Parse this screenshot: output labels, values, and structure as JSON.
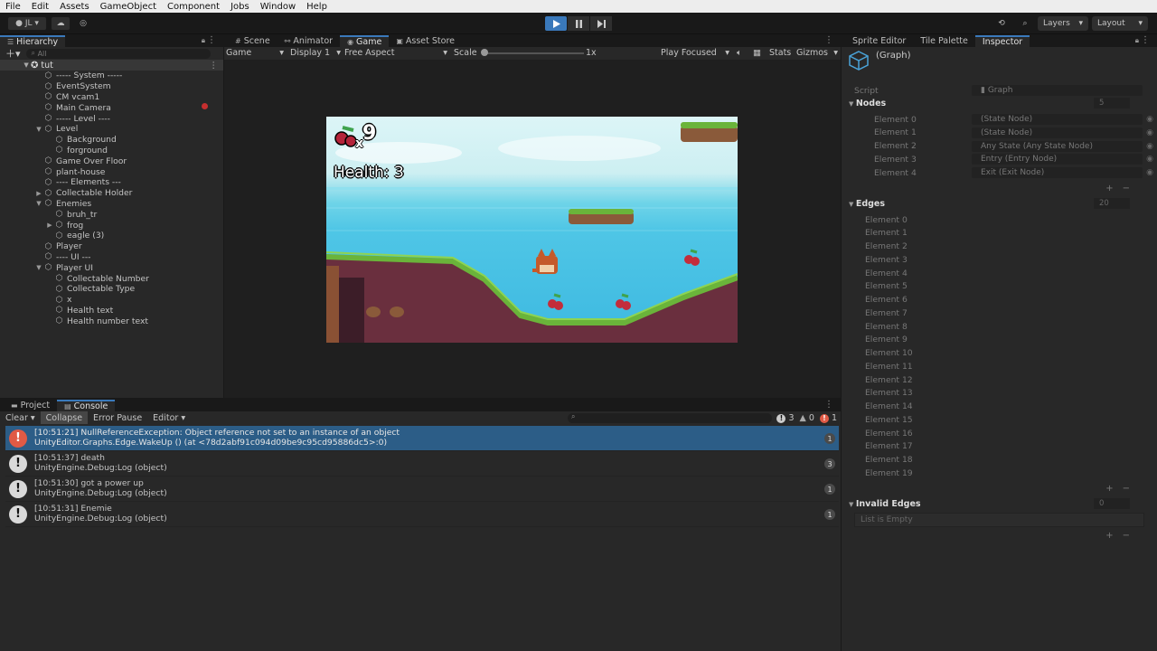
{
  "menu": [
    "File",
    "Edit",
    "Assets",
    "GameObject",
    "Component",
    "Jobs",
    "Window",
    "Help"
  ],
  "toolbar": {
    "account": "JL",
    "layers": "Layers",
    "layout": "Layout"
  },
  "hierarchy": {
    "tab": "Hierarchy",
    "search_placeholder": "All",
    "scene": "tut",
    "items": [
      {
        "label": "----- System -----",
        "depth": 1,
        "fold": ""
      },
      {
        "label": "EventSystem",
        "depth": 1,
        "fold": ""
      },
      {
        "label": "CM vcam1",
        "depth": 1,
        "fold": ""
      },
      {
        "label": "Main Camera",
        "depth": 1,
        "fold": ""
      },
      {
        "label": "----- Level ----",
        "depth": 1,
        "fold": ""
      },
      {
        "label": "Level",
        "depth": 1,
        "fold": "▼"
      },
      {
        "label": "Background",
        "depth": 2,
        "fold": ""
      },
      {
        "label": "forground",
        "depth": 2,
        "fold": ""
      },
      {
        "label": "Game Over Floor",
        "depth": 1,
        "fold": ""
      },
      {
        "label": "plant-house",
        "depth": 1,
        "fold": ""
      },
      {
        "label": "---- Elements ---",
        "depth": 1,
        "fold": ""
      },
      {
        "label": "Collectable Holder",
        "depth": 1,
        "fold": "▶"
      },
      {
        "label": "Enemies",
        "depth": 1,
        "fold": "▼"
      },
      {
        "label": "bruh_tr",
        "depth": 2,
        "fold": ""
      },
      {
        "label": "frog",
        "depth": 2,
        "fold": "▶"
      },
      {
        "label": "eagle (3)",
        "depth": 2,
        "fold": ""
      },
      {
        "label": "Player",
        "depth": 1,
        "fold": ""
      },
      {
        "label": "---- UI  ---",
        "depth": 1,
        "fold": ""
      },
      {
        "label": "Player UI",
        "depth": 1,
        "fold": "▼"
      },
      {
        "label": "Collectable Number",
        "depth": 2,
        "fold": ""
      },
      {
        "label": "Collectable Type",
        "depth": 2,
        "fold": ""
      },
      {
        "label": "x",
        "depth": 2,
        "fold": ""
      },
      {
        "label": "Health text",
        "depth": 2,
        "fold": ""
      },
      {
        "label": "Health number text",
        "depth": 2,
        "fold": ""
      }
    ]
  },
  "center_tabs": [
    {
      "label": "Scene",
      "icon": "#"
    },
    {
      "label": "Animator",
      "icon": "⚯"
    },
    {
      "label": "Game",
      "icon": "◉",
      "active": true
    },
    {
      "label": "Asset Store",
      "icon": "▣"
    }
  ],
  "game_toolbar": {
    "mode": "Game",
    "display": "Display 1",
    "aspect": "Free Aspect",
    "scale_label": "Scale",
    "scale_value": "1x",
    "play_mode": "Play Focused",
    "stats": "Stats",
    "gizmos": "Gizmos"
  },
  "game": {
    "cherry_count": "9",
    "x_label": "x",
    "health_text": "Health: 3"
  },
  "bottom_tabs": [
    {
      "label": "Project",
      "icon": "▬"
    },
    {
      "label": "Console",
      "icon": "▤",
      "active": true
    }
  ],
  "console": {
    "clear": "Clear",
    "collapse": "Collapse",
    "error_pause": "Error Pause",
    "editor": "Editor",
    "log_count": "3",
    "warn_count": "0",
    "error_count": "1",
    "entries": [
      {
        "type": "error",
        "line1": "[10:51:21] NullReferenceException: Object reference not set to an instance of an object",
        "line2": "UnityEditor.Graphs.Edge.WakeUp () (at <78d2abf91c094d09be9c95cd95886dc5>:0)",
        "count": "1"
      },
      {
        "type": "log",
        "line1": "[10:51:37] death",
        "line2": "UnityEngine.Debug:Log (object)",
        "count": "3"
      },
      {
        "type": "log",
        "line1": "[10:51:30] got a power up",
        "line2": "UnityEngine.Debug:Log (object)",
        "count": "1"
      },
      {
        "type": "log",
        "line1": "[10:51:31] Enemie",
        "line2": "UnityEngine.Debug:Log (object)",
        "count": "1"
      }
    ]
  },
  "right_tabs": [
    {
      "label": "Sprite Editor"
    },
    {
      "label": "Tile Palette"
    },
    {
      "label": "Inspector",
      "active": true
    }
  ],
  "inspector": {
    "title": "(Graph)",
    "script_label": "Script",
    "script_value": "Graph",
    "nodes_label": "Nodes",
    "nodes_count": "5",
    "nodes": [
      {
        "label": "Element 0",
        "value": "(State Node)"
      },
      {
        "label": "Element 1",
        "value": "(State Node)"
      },
      {
        "label": "Element 2",
        "value": "Any State (Any State Node)"
      },
      {
        "label": "Element 3",
        "value": "Entry (Entry Node)"
      },
      {
        "label": "Element 4",
        "value": "Exit (Exit Node)"
      }
    ],
    "edges_label": "Edges",
    "edges_count": "20",
    "edges": [
      "Element 0",
      "Element 1",
      "Element 2",
      "Element 3",
      "Element 4",
      "Element 5",
      "Element 6",
      "Element 7",
      "Element 8",
      "Element 9",
      "Element 10",
      "Element 11",
      "Element 12",
      "Element 13",
      "Element 14",
      "Element 15",
      "Element 16",
      "Element 17",
      "Element 18",
      "Element 19"
    ],
    "invalid_edges_label": "Invalid Edges",
    "invalid_edges_count": "0",
    "list_empty": "List is Empty"
  }
}
